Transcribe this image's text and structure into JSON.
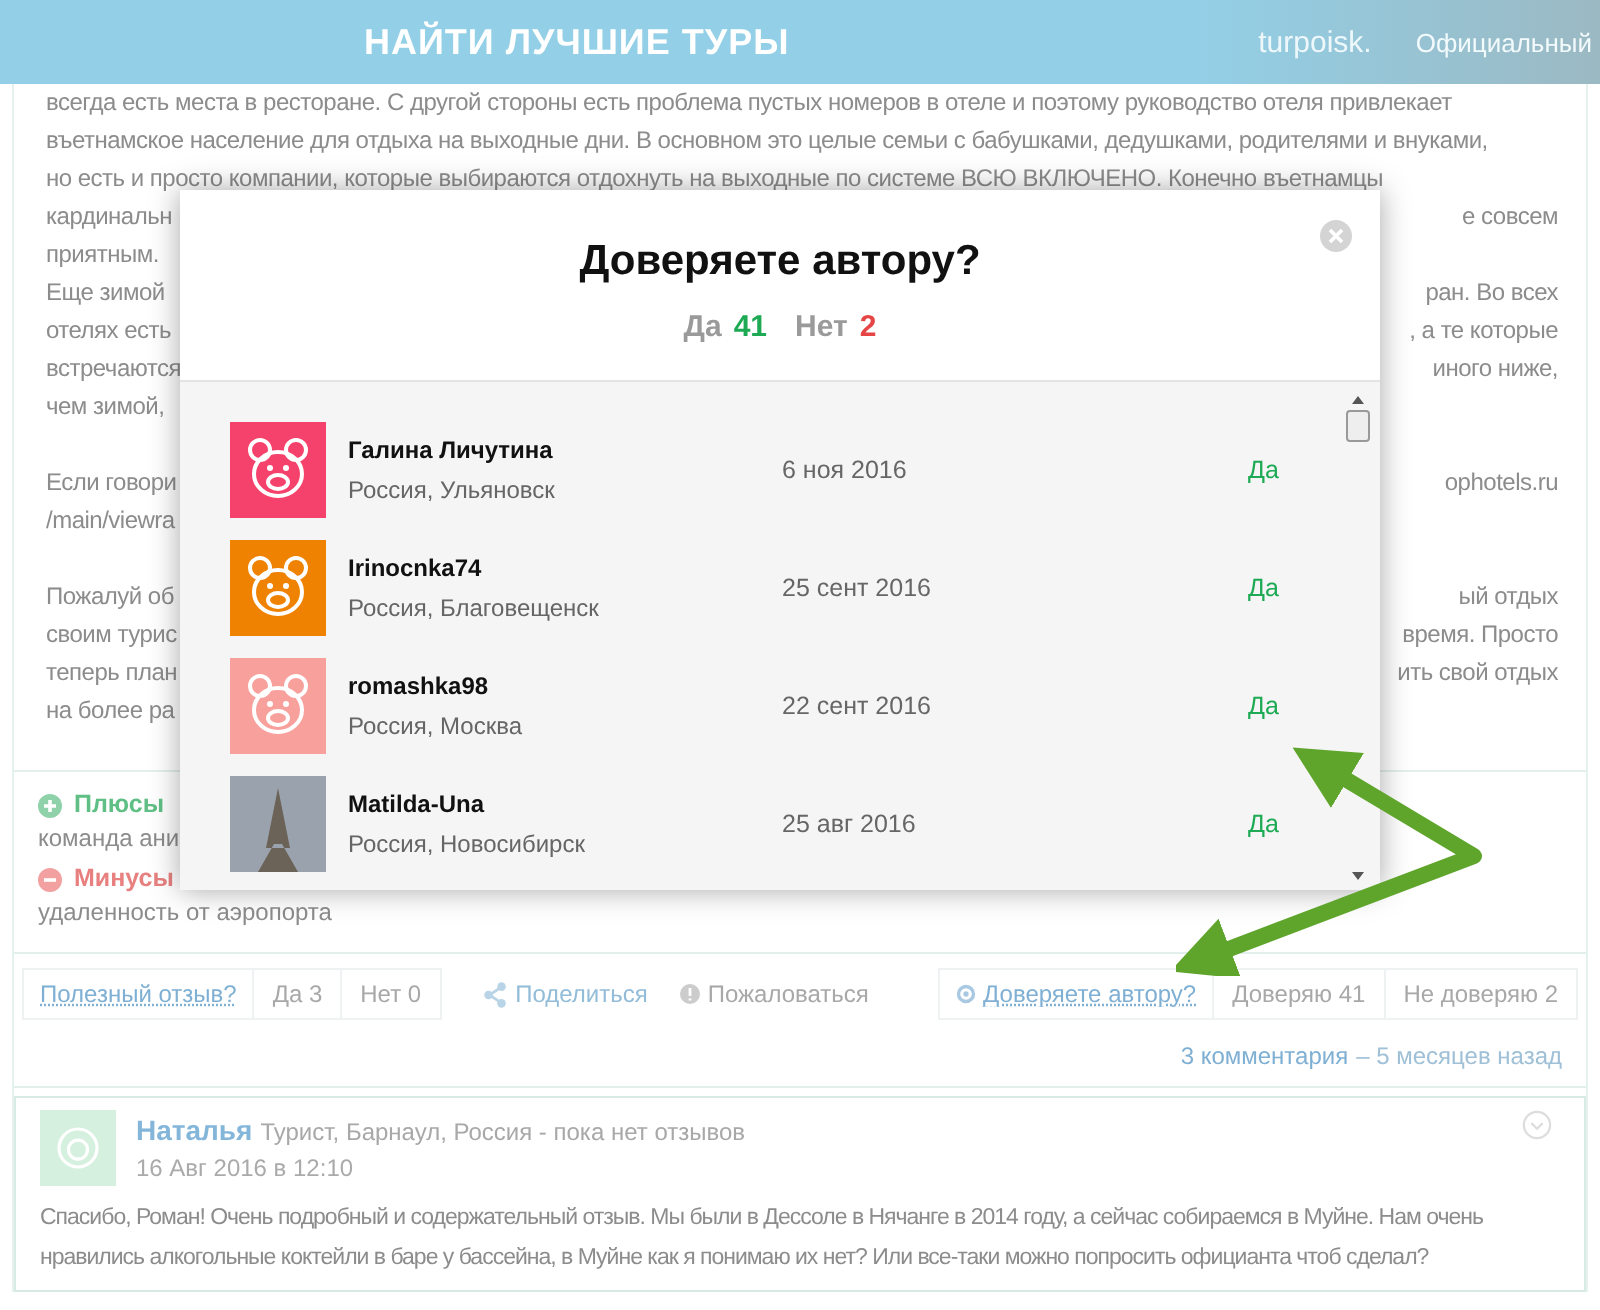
{
  "header": {
    "title": "НАЙТИ ЛУЧШИЕ ТУРЫ",
    "logo": "turpoisk.",
    "link": "Официальный"
  },
  "review": {
    "paragraphs": [
      [
        {
          "left": "всегда есть места в ресторане. С другой стороны есть проблема пустых номеров в отеле и поэтому руководство отеля привлекает"
        },
        {
          "left": "въетнамское население для отдыха на выходные дни. В основном это целые семьи с бабушками, дедушками, родителями и внуками,"
        },
        {
          "left": "но есть и просто компании, которые выбираются отдохнуть на выходные по системе ВСЮ ВКЛЮЧЕНО. Конечно въетнамцы"
        },
        {
          "left": "кардинальн",
          "right": "е совсем"
        },
        {
          "left": "приятным."
        },
        {
          "left": "Еще зимой",
          "right": "ран. Во всех"
        },
        {
          "left": "отелях есть",
          "right": ", а те которые"
        },
        {
          "left": "встречаются",
          "right": "иного ниже,"
        },
        {
          "left": "чем зимой,"
        }
      ],
      [
        {
          "left": "Если говори",
          "right": "ophotels.ru"
        },
        {
          "left": "/main/viewra"
        }
      ],
      [
        {
          "left": "Пожалуй об",
          "right": "ый отдых"
        },
        {
          "left": "своим турис",
          "right": "время. Просто"
        },
        {
          "left": "теперь план",
          "right": "ить свой отдых"
        },
        {
          "left": "на более ра"
        }
      ]
    ],
    "pros": {
      "label": "Плюсы",
      "text": "команда ани"
    },
    "cons": {
      "label": "Минусы",
      "text": "удаленность от аэропорта"
    }
  },
  "actions": {
    "useful": "Полезный отзыв?",
    "yes": "Да 3",
    "no": "Нет 0",
    "share": "Поделиться",
    "report": "Пожаловаться",
    "trust": "Доверяете автору?",
    "trust_yes": "Доверяю 41",
    "trust_no": "Не доверяю 2"
  },
  "meta": {
    "comments": "3 комментария",
    "age": "– 5 месяцев назад"
  },
  "comment": {
    "author": "Наталья",
    "info": "Турист, Барнаул, Россия - пока нет отзывов",
    "date": "16 Авг 2016 в 12:10",
    "text": "Спасибо, Роман! Очень подробный и содержательный отзыв. Мы были в Дессоле в Нячанге в 2014 году, а сейчас собираемся в Муйне. Нам очень нравились алкогольные коктейли в баре у бассейна, в Муйне как я понимаю их нет? Или все-таки можно попросить официанта чтоб сделал?"
  },
  "modal": {
    "title": "Доверяете автору?",
    "yes_label": "Да",
    "yes_count": "41",
    "no_label": "Нет",
    "no_count": "2",
    "voters": [
      {
        "name": "Галина Личутина",
        "location": "Россия, Ульяновск",
        "date": "6 ноя 2016",
        "vote": "Да",
        "kind": "icon",
        "color": "#f5426c"
      },
      {
        "name": "Irinocnka74",
        "location": "Россия, Благовещенск",
        "date": "25 сент 2016",
        "vote": "Да",
        "kind": "icon",
        "color": "#ef8200"
      },
      {
        "name": "romashka98",
        "location": "Россия, Москва",
        "date": "22 сент 2016",
        "vote": "Да",
        "kind": "icon",
        "color": "#f7a09c"
      },
      {
        "name": "Matilda-Una",
        "location": "Россия, Новосибирск",
        "date": "25 авг 2016",
        "vote": "Да",
        "kind": "photo",
        "color": "#9aa3ad"
      }
    ]
  }
}
